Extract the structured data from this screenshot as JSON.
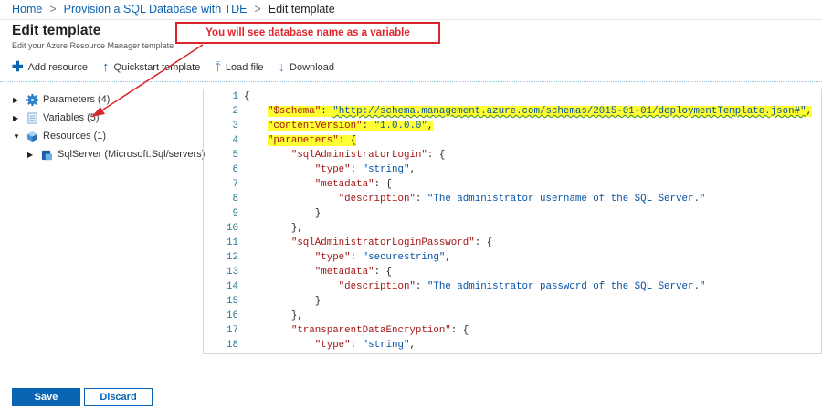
{
  "breadcrumb": {
    "home": "Home",
    "parent": "Provision a SQL Database with TDE",
    "current": "Edit template",
    "sep": ">"
  },
  "header": {
    "title": "Edit template",
    "subtitle": "Edit your Azure Resource Manager template"
  },
  "annotation": "You will see database name as a variable",
  "toolbar": {
    "add_resource": "Add resource",
    "quickstart": "Quickstart template",
    "load_file": "Load file",
    "download": "Download"
  },
  "tree": {
    "parameters": "Parameters (4)",
    "variables": "Variables (5)",
    "resources": "Resources (1)",
    "sqlserver": "SqlServer (Microsoft.Sql/servers)"
  },
  "editor": {
    "lines": [
      [
        [
          "p",
          "{"
        ]
      ],
      [
        [
          "p",
          "    "
        ],
        [
          "kh",
          "\"$schema\""
        ],
        [
          "ph",
          ": "
        ],
        [
          "su",
          "\"http://schema.management.azure.com/schemas/2015-01-01/deploymentTemplate.json#\""
        ],
        [
          "ph",
          ","
        ]
      ],
      [
        [
          "p",
          "    "
        ],
        [
          "kh",
          "\"contentVersion\""
        ],
        [
          "ph",
          ": "
        ],
        [
          "sh",
          "\"1.0.0.0\""
        ],
        [
          "ph",
          ","
        ]
      ],
      [
        [
          "p",
          "    "
        ],
        [
          "kh",
          "\"parameters\""
        ],
        [
          "ph",
          ": {"
        ]
      ],
      [
        [
          "p",
          "        "
        ],
        [
          "k",
          "\"sqlAdministratorLogin\""
        ],
        [
          "p",
          ": {"
        ]
      ],
      [
        [
          "p",
          "            "
        ],
        [
          "k",
          "\"type\""
        ],
        [
          "p",
          ": "
        ],
        [
          "s",
          "\"string\""
        ],
        [
          "p",
          ","
        ]
      ],
      [
        [
          "p",
          "            "
        ],
        [
          "k",
          "\"metadata\""
        ],
        [
          "p",
          ": {"
        ]
      ],
      [
        [
          "p",
          "                "
        ],
        [
          "k",
          "\"description\""
        ],
        [
          "p",
          ": "
        ],
        [
          "s",
          "\"The administrator username of the SQL Server.\""
        ]
      ],
      [
        [
          "p",
          "            }"
        ]
      ],
      [
        [
          "p",
          "        },"
        ]
      ],
      [
        [
          "p",
          "        "
        ],
        [
          "k",
          "\"sqlAdministratorLoginPassword\""
        ],
        [
          "p",
          ": {"
        ]
      ],
      [
        [
          "p",
          "            "
        ],
        [
          "k",
          "\"type\""
        ],
        [
          "p",
          ": "
        ],
        [
          "s",
          "\"securestring\""
        ],
        [
          "p",
          ","
        ]
      ],
      [
        [
          "p",
          "            "
        ],
        [
          "k",
          "\"metadata\""
        ],
        [
          "p",
          ": {"
        ]
      ],
      [
        [
          "p",
          "                "
        ],
        [
          "k",
          "\"description\""
        ],
        [
          "p",
          ": "
        ],
        [
          "s",
          "\"The administrator password of the SQL Server.\""
        ]
      ],
      [
        [
          "p",
          "            }"
        ]
      ],
      [
        [
          "p",
          "        },"
        ]
      ],
      [
        [
          "p",
          "        "
        ],
        [
          "k",
          "\"transparentDataEncryption\""
        ],
        [
          "p",
          ": {"
        ]
      ],
      [
        [
          "p",
          "            "
        ],
        [
          "k",
          "\"type\""
        ],
        [
          "p",
          ": "
        ],
        [
          "s",
          "\"string\""
        ],
        [
          "p",
          ","
        ]
      ]
    ]
  },
  "footer": {
    "save": "Save",
    "discard": "Discard"
  }
}
